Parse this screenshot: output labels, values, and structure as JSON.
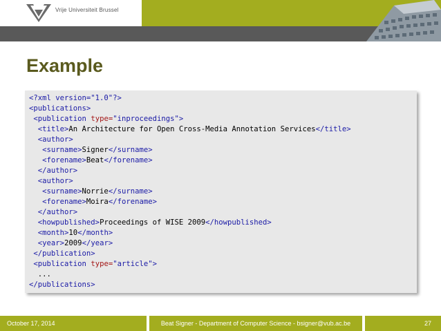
{
  "header": {
    "logo_text": "Vrije Universiteit Brussel",
    "logo_icon": "vub-logo-icon",
    "photo_icon": "building-photo-icon"
  },
  "slide": {
    "title": "Example"
  },
  "code": {
    "lines": [
      [
        {
          "t": "<?xml version=\"1.0\"?>",
          "c": "tag"
        }
      ],
      [
        {
          "t": "<publications>",
          "c": "tag"
        }
      ],
      [
        {
          "t": " "
        },
        {
          "t": "<publication ",
          "c": "tag"
        },
        {
          "t": "type=",
          "c": "attr"
        },
        {
          "t": "\"inproceedings\"",
          "c": "tag"
        },
        {
          "t": ">",
          "c": "tag"
        }
      ],
      [
        {
          "t": "  "
        },
        {
          "t": "<title>",
          "c": "tag"
        },
        {
          "t": "An Architecture for Open Cross-Media Annotation Services"
        },
        {
          "t": "</title>",
          "c": "tag"
        }
      ],
      [
        {
          "t": "  "
        },
        {
          "t": "<author>",
          "c": "tag"
        }
      ],
      [
        {
          "t": "   "
        },
        {
          "t": "<surname>",
          "c": "tag"
        },
        {
          "t": "Signer"
        },
        {
          "t": "</surname>",
          "c": "tag"
        }
      ],
      [
        {
          "t": "   "
        },
        {
          "t": "<forename>",
          "c": "tag"
        },
        {
          "t": "Beat"
        },
        {
          "t": "</forename>",
          "c": "tag"
        }
      ],
      [
        {
          "t": "  "
        },
        {
          "t": "</author>",
          "c": "tag"
        }
      ],
      [
        {
          "t": "  "
        },
        {
          "t": "<author>",
          "c": "tag"
        }
      ],
      [
        {
          "t": "   "
        },
        {
          "t": "<surname>",
          "c": "tag"
        },
        {
          "t": "Norrie"
        },
        {
          "t": "</surname>",
          "c": "tag"
        }
      ],
      [
        {
          "t": "   "
        },
        {
          "t": "<forename>",
          "c": "tag"
        },
        {
          "t": "Moira"
        },
        {
          "t": "</forename>",
          "c": "tag"
        }
      ],
      [
        {
          "t": "  "
        },
        {
          "t": "</author>",
          "c": "tag"
        }
      ],
      [
        {
          "t": "  "
        },
        {
          "t": "<howpublished>",
          "c": "tag"
        },
        {
          "t": "Proceedings of WISE 2009"
        },
        {
          "t": "</howpublished>",
          "c": "tag"
        }
      ],
      [
        {
          "t": "  "
        },
        {
          "t": "<month>",
          "c": "tag"
        },
        {
          "t": "10"
        },
        {
          "t": "</month>",
          "c": "tag"
        }
      ],
      [
        {
          "t": "  "
        },
        {
          "t": "<year>",
          "c": "tag"
        },
        {
          "t": "2009"
        },
        {
          "t": "</year>",
          "c": "tag"
        }
      ],
      [
        {
          "t": " "
        },
        {
          "t": "</publication>",
          "c": "tag"
        }
      ],
      [
        {
          "t": " "
        },
        {
          "t": "<publication ",
          "c": "tag"
        },
        {
          "t": "type=",
          "c": "attr"
        },
        {
          "t": "\"article\"",
          "c": "tag"
        },
        {
          "t": ">",
          "c": "tag"
        }
      ],
      [
        {
          "t": "  ..."
        }
      ],
      [
        {
          "t": "</publications>",
          "c": "tag"
        }
      ]
    ]
  },
  "footer": {
    "date": "October 17, 2014",
    "center": "Beat Signer - Department of Computer Science - bsigner@vub.ac.be",
    "page": "27"
  },
  "colors": {
    "accent": "#a3ad1f",
    "title": "#5a5a1e",
    "band": "#595959",
    "tag": "#1a1aa6",
    "attr": "#a31515"
  }
}
